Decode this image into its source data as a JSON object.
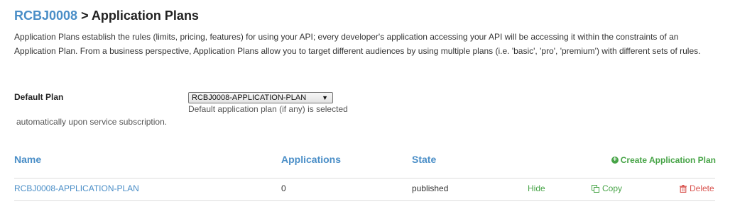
{
  "header": {
    "service_name": "RCBJ0008",
    "separator": " > ",
    "page_title": "Application Plans"
  },
  "intro": {
    "description": "Application Plans establish the rules (limits, pricing, features) for using your API; every developer's application accessing your API will be accessing it within the constraints of an Application Plan. From a business perspective, Application Plans allow you to target different audiences by using multiple plans (i.e. 'basic', 'pro', 'premium') with different sets of rules."
  },
  "default_plan": {
    "label": "Default Plan",
    "selected_value": "RCBJ0008-APPLICATION-PLAN",
    "hint_line1": "Default application plan (if any) is selected",
    "hint_line2": "automatically upon service subscription."
  },
  "table": {
    "columns": {
      "name": "Name",
      "applications": "Applications",
      "state": "State"
    },
    "create_label": "Create Application Plan",
    "rows": [
      {
        "name": "RCBJ0008-APPLICATION-PLAN",
        "applications": "0",
        "state": "published",
        "hide_label": "Hide",
        "copy_label": "Copy",
        "delete_label": "Delete"
      }
    ]
  },
  "colors": {
    "link_blue": "#4a8ec7",
    "action_green": "#47a447",
    "danger_red": "#d9534f"
  },
  "icons": {
    "create": "plus-circle-icon",
    "copy": "copy-icon",
    "delete": "trash-icon",
    "select": "triangle-down-icon"
  }
}
